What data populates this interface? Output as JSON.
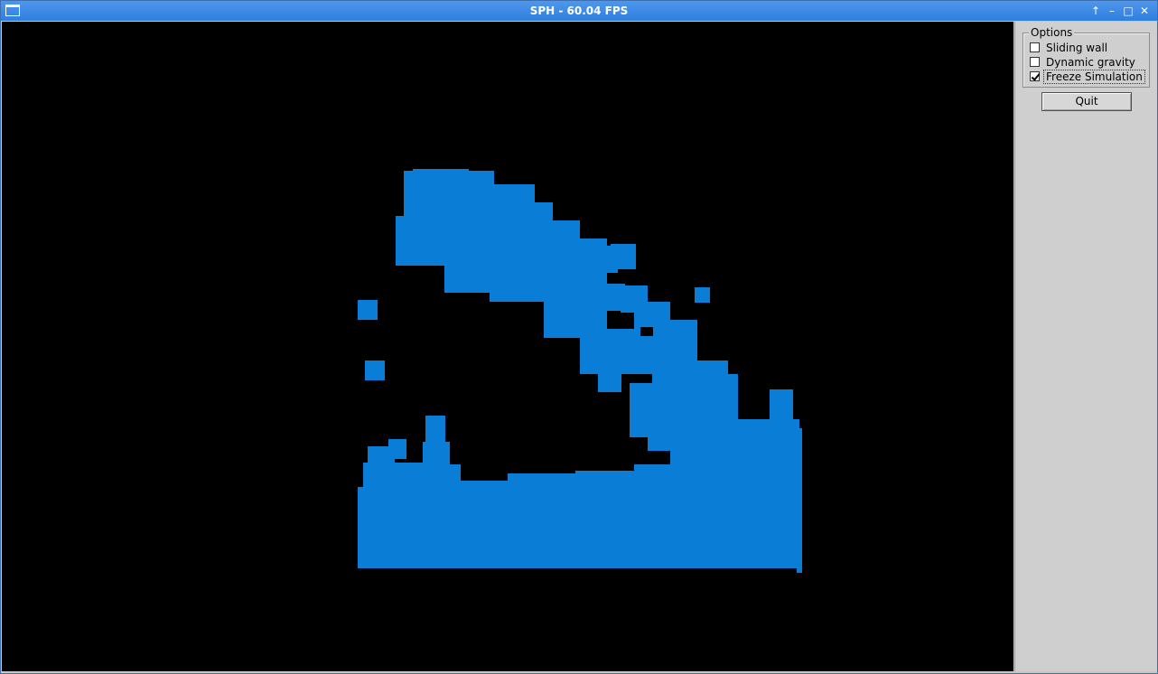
{
  "window": {
    "title": "SPH - 60.04 FPS"
  },
  "titlebar_controls": [
    {
      "icon": "arrow-up-icon",
      "glyph": "↑"
    },
    {
      "icon": "minimize-icon",
      "glyph": "–"
    },
    {
      "icon": "maximize-icon",
      "glyph": "□"
    },
    {
      "icon": "close-icon",
      "glyph": "✕"
    }
  ],
  "options": {
    "group_label": "Options",
    "items": [
      {
        "label": "Sliding wall",
        "checked": false
      },
      {
        "label": "Dynamic gravity",
        "checked": false
      },
      {
        "label": "Freeze Simulation",
        "checked": true
      }
    ]
  },
  "quit_label": "Quit",
  "colors": {
    "particles": "#0a7ed6",
    "background": "#000000",
    "panel": "#cfcfcf",
    "titlebar": "#3b88e6"
  }
}
